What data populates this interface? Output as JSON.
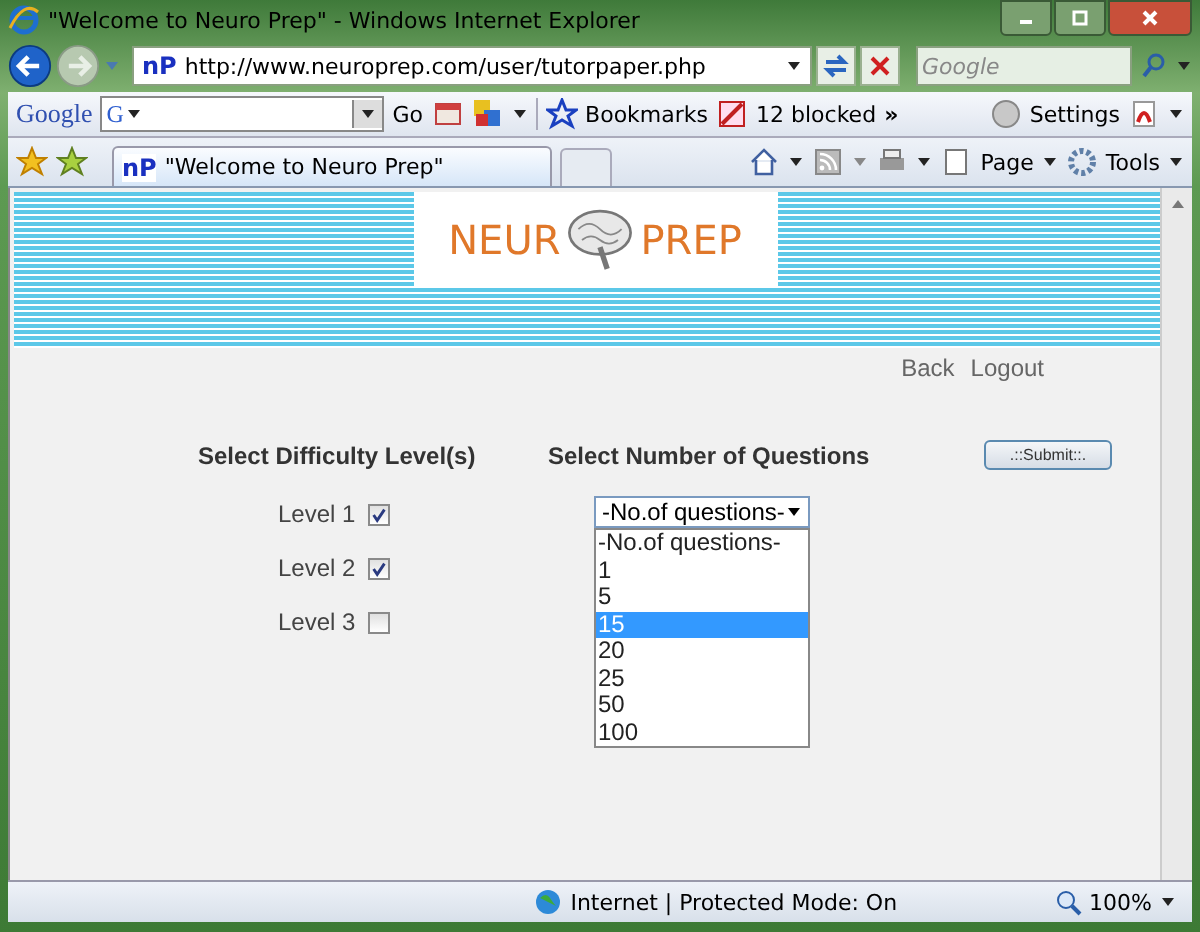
{
  "window": {
    "title": "\"Welcome to Neuro Prep\" - Windows Internet Explorer"
  },
  "address_bar": {
    "favicon": "nP",
    "url": "http://www.neuroprep.com/user/tutorpaper.php"
  },
  "search": {
    "placeholder": "Google"
  },
  "google_toolbar": {
    "logo": "Google",
    "engine": "G",
    "go": "Go",
    "bookmarks": "Bookmarks",
    "blocked": "12 blocked",
    "more": "»",
    "settings": "Settings"
  },
  "tab": {
    "favicon": "nP",
    "title": "\"Welcome to Neuro Prep\""
  },
  "command_bar": {
    "page": "Page",
    "tools": "Tools"
  },
  "logo": {
    "left": "NEUR",
    "right": "PREP"
  },
  "links": [
    "Back",
    "Logout"
  ],
  "difficulty_heading": "Select Difficulty Level(s)",
  "questions_heading": "Select Number of Questions",
  "submit": ".::Submit::.",
  "levels": [
    {
      "label": "Level 1",
      "checked": true
    },
    {
      "label": "Level 2",
      "checked": true
    },
    {
      "label": "Level 3",
      "checked": false
    }
  ],
  "dropdown": {
    "value": "-No.of questions-",
    "expanded": true,
    "options": [
      {
        "label": "-No.of questions-",
        "highlighted": false
      },
      {
        "label": "1",
        "highlighted": false
      },
      {
        "label": "5",
        "highlighted": false
      },
      {
        "label": "15",
        "highlighted": true
      },
      {
        "label": "20",
        "highlighted": false
      },
      {
        "label": "25",
        "highlighted": false
      },
      {
        "label": "50",
        "highlighted": false
      },
      {
        "label": "100",
        "highlighted": false
      }
    ]
  },
  "status_bar": {
    "zone": "Internet | Protected Mode: On",
    "zoom": "100%"
  }
}
